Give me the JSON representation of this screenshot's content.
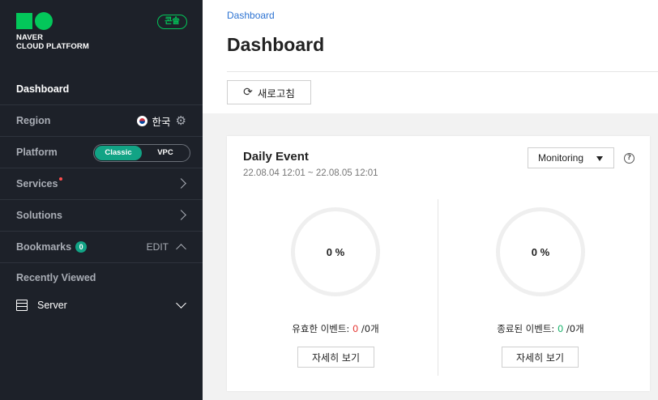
{
  "brand": {
    "logo_line1": "NAVER",
    "logo_line2": "CLOUD PLATFORM",
    "console_badge": "콘솔",
    "brand_color": "#03c75a"
  },
  "sidebar": {
    "dashboard_label": "Dashboard",
    "region_label": "Region",
    "region_value": "한국",
    "platform_label": "Platform",
    "platform_options": [
      "Classic",
      "VPC"
    ],
    "platform_selected": "Classic",
    "services_label": "Services",
    "solutions_label": "Solutions",
    "bookmarks_label": "Bookmarks",
    "bookmarks_count": "0",
    "bookmarks_edit": "EDIT",
    "recently_viewed_label": "Recently Viewed",
    "recent_items": [
      {
        "label": "Server",
        "icon": "server-icon"
      }
    ],
    "accent_color": "#12a385"
  },
  "header": {
    "breadcrumb": "Dashboard",
    "title": "Dashboard",
    "refresh_label": "새로고침"
  },
  "daily_event": {
    "title": "Daily Event",
    "date_range": "22.08.04 12:01 ~ 22.08.05 12:01",
    "filter_selected": "Monitoring",
    "help": "?",
    "active": {
      "percent": "0 %",
      "label": "유효한 이벤트: ",
      "count": "0",
      "total": " /0개",
      "detail_button": "자세히 보기"
    },
    "closed": {
      "percent": "0 %",
      "label": "종료된 이벤트: ",
      "count": "0",
      "total": " /0개",
      "detail_button": "자세히 보기"
    }
  }
}
